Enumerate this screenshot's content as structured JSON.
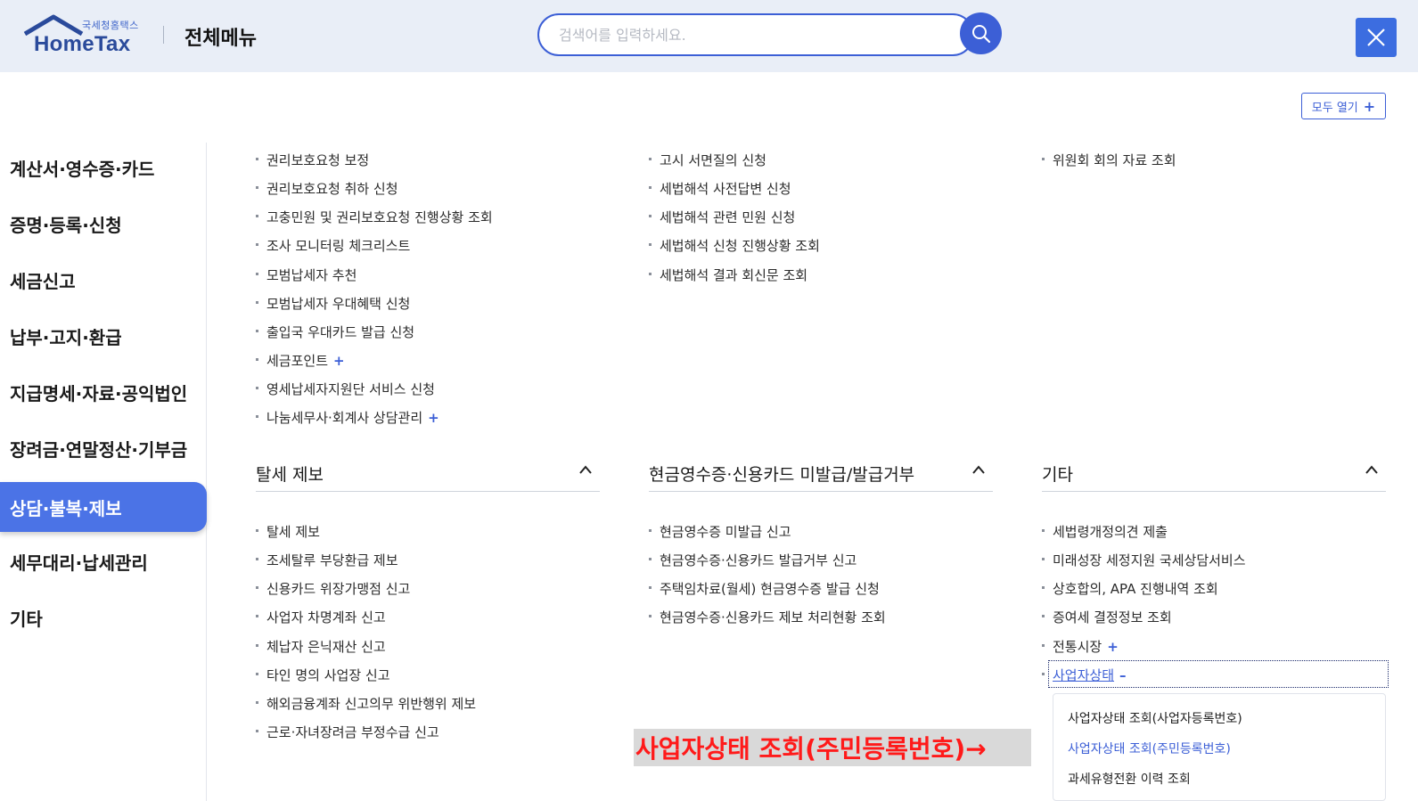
{
  "header": {
    "logo_sub": "국세청홈택스",
    "logo_main": "HomeTax",
    "menu_title": "전체메뉴",
    "search_placeholder": "검색어를 입력하세요."
  },
  "open_all_label": "모두 열기",
  "sidebar": {
    "items": [
      {
        "label": "계산서·영수증·카드"
      },
      {
        "label": "증명·등록·신청"
      },
      {
        "label": "세금신고"
      },
      {
        "label": "납부·고지·환급"
      },
      {
        "label": "지급명세·자료·공익법인"
      },
      {
        "label": "장려금·연말정산·기부금"
      },
      {
        "label": "상담·불복·제보"
      },
      {
        "label": "세무대리·납세관리"
      },
      {
        "label": "기타"
      }
    ],
    "active_index": 6
  },
  "top": {
    "col1": [
      "권리보호요청 보정",
      "권리보호요청 취하 신청",
      "고충민원 및 권리보호요청 진행상황 조회",
      "조사 모니터링 체크리스트",
      "모범납세자 추천",
      "모범납세자 우대혜택 신청",
      "출입국 우대카드 발급 신청",
      "세금포인트",
      "영세납세자지원단 서비스 신청",
      "나눔세무사·회계사 상담관리"
    ],
    "col2": [
      "고시 서면질의 신청",
      "세법해석 사전답변 신청",
      "세법해석 관련 민원 신청",
      "세법해석 신청 진행상황 조회",
      "세법해석 결과 회신문 조회"
    ],
    "col3": [
      "위원회 회의 자료 조회"
    ]
  },
  "sections": {
    "tax_report": {
      "title": "탈세 제보",
      "items": [
        "탈세 제보",
        "조세탈루 부당환급 제보",
        "신용카드 위장가맹점 신고",
        "사업자 차명계좌 신고",
        "체납자 은닉재산 신고",
        "타인 명의 사업장 신고",
        "해외금융계좌 신고의무 위반행위 제보",
        "근로·자녀장려금 부정수급 신고"
      ]
    },
    "cash_receipt": {
      "title": "현금영수증·신용카드 미발급/발급거부",
      "items": [
        "현금영수증 미발급 신고",
        "현금영수증·신용카드 발급거부 신고",
        "주택임차료(월세) 현금영수증 발급 신청",
        "현금영수증·신용카드 제보 처리현황 조회"
      ]
    },
    "etc": {
      "title": "기타",
      "items": [
        "세법령개정의견 제출",
        "미래성장 세정지원 국세상담서비스",
        "상호합의, APA 진행내역 조회",
        "증여세 결정정보 조회",
        "전통시장",
        "사업자상태"
      ]
    }
  },
  "submenu": {
    "items": [
      "사업자상태 조회(사업자등록번호)",
      "사업자상태 조회(주민등록번호)",
      "과세유형전환 이력 조회"
    ],
    "selected_index": 1
  },
  "annotation": "사업자상태 조회(주민등록번호)→",
  "colors": {
    "accent": "#3c5fd6",
    "active_bg": "#4b73e6",
    "header_bg": "#e9eef7",
    "annotation_text": "#ff1a1a"
  }
}
